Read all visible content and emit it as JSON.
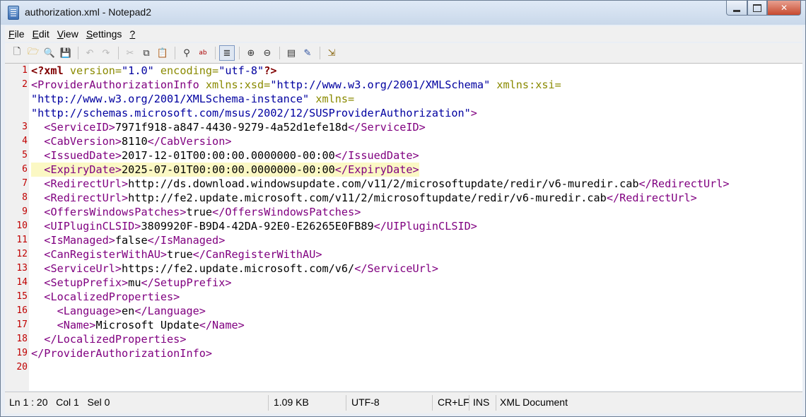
{
  "window": {
    "title": "authorization.xml - Notepad2"
  },
  "menu": [
    "File",
    "Edit",
    "View",
    "Settings",
    "?"
  ],
  "menu_underline": [
    "F",
    "E",
    "V",
    "S",
    "?"
  ],
  "menu_rest": [
    "ile",
    "dit",
    "iew",
    "ettings",
    ""
  ],
  "editor": {
    "highlighted_line": 6,
    "lines": [
      {
        "n": "1",
        "segs": [
          [
            "decl",
            "<?xml "
          ],
          [
            "attr",
            "version="
          ],
          [
            "aval",
            "\"1.0\""
          ],
          [
            "attr",
            " encoding="
          ],
          [
            "aval",
            "\"utf-8\""
          ],
          [
            "decl",
            "?>"
          ]
        ]
      },
      {
        "n": "2",
        "segs": [
          [
            "tag",
            "<ProviderAuthorizationInfo "
          ],
          [
            "attr",
            "xmlns:xsd="
          ],
          [
            "aval",
            "\"http://www.w3.org/2001/XMLSchema\""
          ],
          [
            "attr",
            " xmlns:xsi="
          ]
        ]
      },
      {
        "n": "",
        "segs": [
          [
            "aval",
            "\"http://www.w3.org/2001/XMLSchema-instance\""
          ],
          [
            "attr",
            " xmlns="
          ]
        ]
      },
      {
        "n": "",
        "segs": [
          [
            "aval",
            "\"http://schemas.microsoft.com/msus/2002/12/SUSProviderAuthorization\""
          ],
          [
            "tag",
            ">"
          ]
        ]
      },
      {
        "n": "3",
        "segs": [
          [
            "val",
            "  "
          ],
          [
            "tag",
            "<ServiceID>"
          ],
          [
            "val",
            "7971f918-a847-4430-9279-4a52d1efe18d"
          ],
          [
            "tag",
            "</ServiceID>"
          ]
        ]
      },
      {
        "n": "4",
        "segs": [
          [
            "val",
            "  "
          ],
          [
            "tag",
            "<CabVersion>"
          ],
          [
            "val",
            "8110"
          ],
          [
            "tag",
            "</CabVersion>"
          ]
        ]
      },
      {
        "n": "5",
        "segs": [
          [
            "val",
            "  "
          ],
          [
            "tag",
            "<IssuedDate>"
          ],
          [
            "val",
            "2017-12-01T00:00:00.0000000-00:00"
          ],
          [
            "tag",
            "</IssuedDate>"
          ]
        ]
      },
      {
        "n": "6",
        "segs": [
          [
            "val",
            "  "
          ],
          [
            "tag",
            "<ExpiryDate>"
          ],
          [
            "val",
            "2025-07-01T00:00:00.0000000-00:00"
          ],
          [
            "tag",
            "</ExpiryDate>"
          ]
        ]
      },
      {
        "n": "7",
        "segs": [
          [
            "val",
            "  "
          ],
          [
            "tag",
            "<RedirectUrl>"
          ],
          [
            "val",
            "http://ds.download.windowsupdate.com/v11/2/microsoftupdate/redir/v6-muredir.cab"
          ],
          [
            "tag",
            "</RedirectUrl>"
          ]
        ]
      },
      {
        "n": "8",
        "segs": [
          [
            "val",
            "  "
          ],
          [
            "tag",
            "<RedirectUrl>"
          ],
          [
            "val",
            "http://fe2.update.microsoft.com/v11/2/microsoftupdate/redir/v6-muredir.cab"
          ],
          [
            "tag",
            "</RedirectUrl>"
          ]
        ]
      },
      {
        "n": "9",
        "segs": [
          [
            "val",
            "  "
          ],
          [
            "tag",
            "<OffersWindowsPatches>"
          ],
          [
            "val",
            "true"
          ],
          [
            "tag",
            "</OffersWindowsPatches>"
          ]
        ]
      },
      {
        "n": "10",
        "segs": [
          [
            "val",
            "  "
          ],
          [
            "tag",
            "<UIPluginCLSID>"
          ],
          [
            "val",
            "3809920F-B9D4-42DA-92E0-E26265E0FB89"
          ],
          [
            "tag",
            "</UIPluginCLSID>"
          ]
        ]
      },
      {
        "n": "11",
        "segs": [
          [
            "val",
            "  "
          ],
          [
            "tag",
            "<IsManaged>"
          ],
          [
            "val",
            "false"
          ],
          [
            "tag",
            "</IsManaged>"
          ]
        ]
      },
      {
        "n": "12",
        "segs": [
          [
            "val",
            "  "
          ],
          [
            "tag",
            "<CanRegisterWithAU>"
          ],
          [
            "val",
            "true"
          ],
          [
            "tag",
            "</CanRegisterWithAU>"
          ]
        ]
      },
      {
        "n": "13",
        "segs": [
          [
            "val",
            "  "
          ],
          [
            "tag",
            "<ServiceUrl>"
          ],
          [
            "val",
            "https://fe2.update.microsoft.com/v6/"
          ],
          [
            "tag",
            "</ServiceUrl>"
          ]
        ]
      },
      {
        "n": "14",
        "segs": [
          [
            "val",
            "  "
          ],
          [
            "tag",
            "<SetupPrefix>"
          ],
          [
            "val",
            "mu"
          ],
          [
            "tag",
            "</SetupPrefix>"
          ]
        ]
      },
      {
        "n": "15",
        "segs": [
          [
            "val",
            "  "
          ],
          [
            "tag",
            "<LocalizedProperties>"
          ]
        ]
      },
      {
        "n": "16",
        "segs": [
          [
            "val",
            "    "
          ],
          [
            "tag",
            "<Language>"
          ],
          [
            "val",
            "en"
          ],
          [
            "tag",
            "</Language>"
          ]
        ]
      },
      {
        "n": "17",
        "segs": [
          [
            "val",
            "    "
          ],
          [
            "tag",
            "<Name>"
          ],
          [
            "val",
            "Microsoft Update"
          ],
          [
            "tag",
            "</Name>"
          ]
        ]
      },
      {
        "n": "18",
        "segs": [
          [
            "val",
            "  "
          ],
          [
            "tag",
            "</LocalizedProperties>"
          ]
        ]
      },
      {
        "n": "19",
        "segs": [
          [
            "tag",
            "</ProviderAuthorizationInfo>"
          ]
        ]
      },
      {
        "n": "20",
        "segs": []
      }
    ]
  },
  "status": {
    "position": "Ln 1 : 20   Col 1   Sel 0",
    "size": "1.09 KB",
    "encoding": "UTF-8",
    "eol": "CR+LF",
    "ins": "INS",
    "lexer": "XML Document"
  },
  "colors": {
    "tag": "#800080",
    "line_number": "#c00000",
    "highlight": "#fbf8c4"
  }
}
